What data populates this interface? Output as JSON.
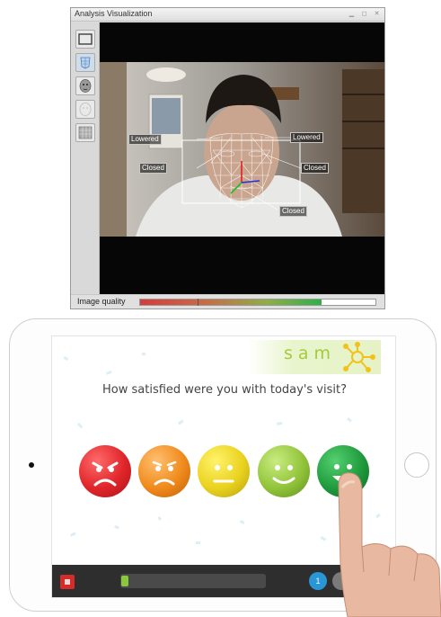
{
  "window": {
    "title": "Analysis Visualization",
    "controls": [
      "minimize-icon",
      "restore-icon",
      "close-icon"
    ],
    "toolbar_icons": [
      "bounding-box-icon",
      "face-mesh-icon",
      "face-model-icon",
      "face-outline-icon",
      "texture-icon"
    ]
  },
  "analysis": {
    "annotations": {
      "left_brow": "Lowered",
      "right_brow": "Lowered",
      "left_eye": "Closed",
      "right_eye": "Closed",
      "mouth": "Closed"
    },
    "image_quality_label": "Image quality",
    "image_quality_level": 0.77
  },
  "tablet": {
    "logo": "sam",
    "question": "How satisfied were you with today's visit?",
    "faces": [
      {
        "name": "very-dissatisfied",
        "color": "#e0252a"
      },
      {
        "name": "dissatisfied",
        "color": "#f08a1c"
      },
      {
        "name": "neutral",
        "color": "#ead21f"
      },
      {
        "name": "satisfied",
        "color": "#92c43a"
      },
      {
        "name": "very-satisfied",
        "color": "#1f9a3c"
      }
    ],
    "bottom_bar": {
      "progress_level": 0.05,
      "count_badge": "1"
    }
  }
}
